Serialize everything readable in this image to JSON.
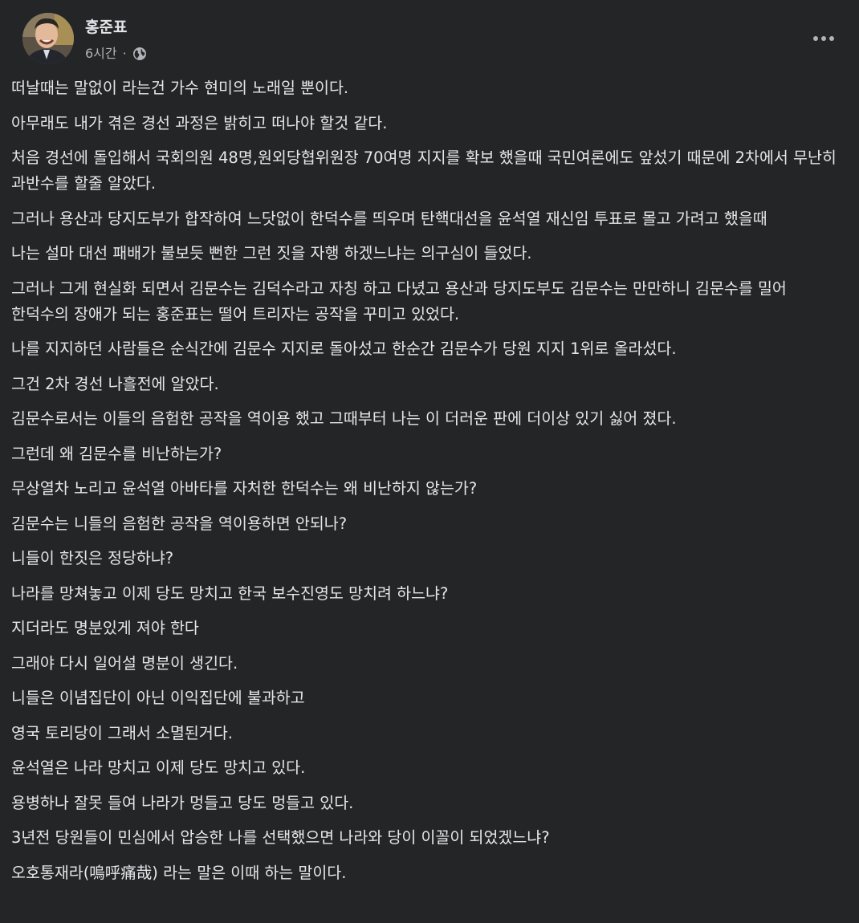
{
  "post": {
    "author": "홍준표",
    "time": "6시간",
    "separator": "·",
    "privacy_icon": "globe-icon",
    "more_icon": "more-options-icon",
    "paragraphs": [
      "떠날때는 말없이 라는건 가수 현미의 노래일 뿐이다.",
      "아무래도 내가 겪은 경선 과정은 밝히고 떠나야 할것 같다.",
      "처음 경선에 돌입해서 국회의원 48명,원외당협위원장 70여명 지지를 확보 했을때 국민여론에도 앞섰기 때문에 2차에서 무난히 과반수를 할줄 알았다.",
      "그러나 용산과 당지도부가 합작하여 느닷없이 한덕수를 띄우며 탄핵대선을 윤석열 재신임 투표로 몰고 가려고 했을때",
      "나는 설마 대선 패배가 불보듯 뻔한 그런 짓을 자행 하겠느냐는 의구심이 들었다.",
      "그러나 그게 현실화 되면서 김문수는 김덕수라고 자칭 하고 다녔고 용산과 당지도부도 김문수는 만만하니 김문수를 밀어 한덕수의 장애가 되는 홍준표는 떨어 트리자는 공작을  꾸미고 있었다.",
      "나를 지지하던 사람들은 순식간에 김문수 지지로 돌아섰고 한순간 김문수가 당원 지지 1위로 올라섰다.",
      "그건 2차 경선 나흘전에 알았다.",
      "김문수로서는 이들의 음험한 공작을 역이용 했고 그때부터 나는 이 더러운 판에 더이상 있기 싫어 졌다.",
      "그런데 왜 김문수를 비난하는가?",
      "무상열차 노리고 윤석열 아바타를 자처한 한덕수는 왜 비난하지 않는가?",
      "김문수는 니들의 음험한 공작을 역이용하면 안되나?",
      "니들이 한짓은 정당하냐?",
      "나라를 망쳐놓고 이제 당도 망치고 한국 보수진영도 망치려 하느냐?",
      "지더라도 명분있게 져야 한다",
      "그래야 다시 일어설 명분이 생긴다.",
      "니들은 이념집단이 아닌 이익집단에 불과하고",
      "영국  토리당이 그래서 소멸된거다.",
      "윤석열은 나라 망치고 이제 당도 망치고 있다.",
      "용병하나 잘못 들여 나라가 멍들고 당도 멍들고 있다.",
      "3년전 당원들이 민심에서 압승한 나를 선택했으면 나라와 당이 이꼴이 되었겠느냐?",
      "오호통재라(嗚呼痛哉) 라는 말은 이때 하는 말이다."
    ]
  },
  "colors": {
    "background": "#242526",
    "primary_text": "#e4e6eb",
    "secondary_text": "#b0b3b8"
  }
}
